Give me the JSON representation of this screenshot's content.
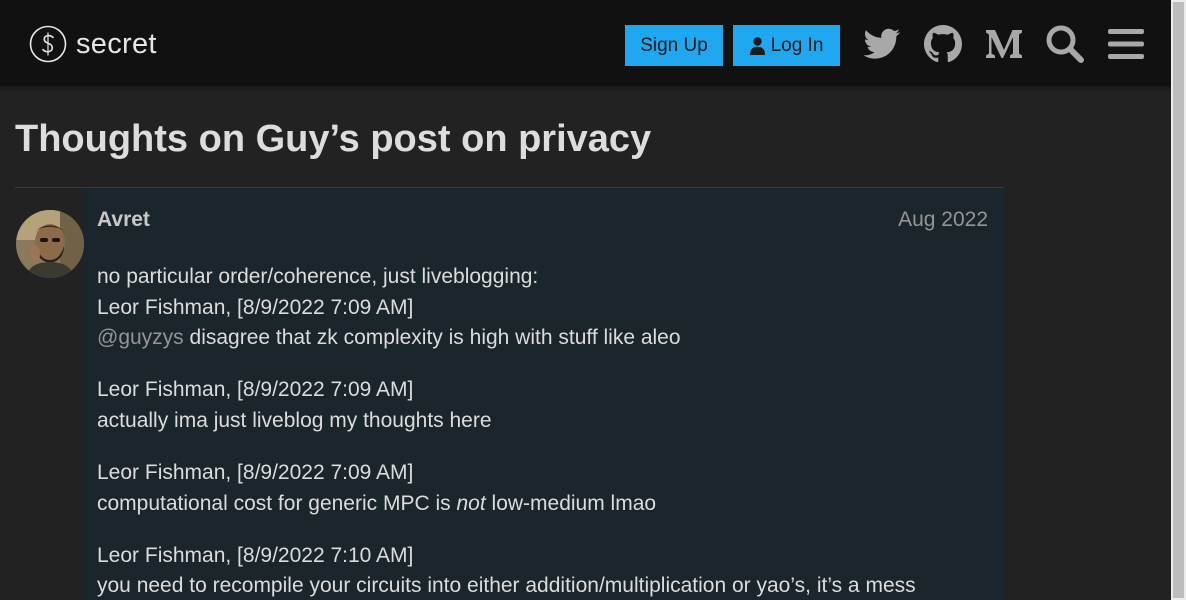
{
  "header": {
    "logo_text": "secret",
    "signup_label": "Sign Up",
    "login_label": "Log In",
    "icons": [
      "twitter-icon",
      "github-icon",
      "medium-icon",
      "search-icon",
      "menu-icon"
    ]
  },
  "topic": {
    "title": "Thoughts on Guy’s post on privacy"
  },
  "post": {
    "username": "Avret",
    "date": "Aug 2022",
    "intro": "no particular order/coherence, just liveblogging:",
    "entries": [
      {
        "author_time": "Leor Fishman, [8/9/2022 7:09 AM]",
        "mention": "@guyzys",
        "text": " disagree that zk complexity is high with stuff like aleo"
      },
      {
        "author_time": "Leor Fishman, [8/9/2022 7:09 AM]",
        "text": "actually ima just liveblog my thoughts here"
      },
      {
        "author_time": "Leor Fishman, [8/9/2022 7:09 AM]",
        "text_before": "computational cost for generic MPC is ",
        "text_em": "not",
        "text_after": " low-medium lmao"
      },
      {
        "author_time": "Leor Fishman, [8/9/2022 7:10 AM]",
        "text": "you need to recompile your circuits into either addition/multiplication or yao’s, it’s a mess"
      }
    ]
  },
  "colors": {
    "header_bg": "#111111",
    "page_bg": "#222222",
    "post_bg": "#1a252c",
    "button_bg": "#1fa8f0",
    "text": "#dcdcdc",
    "muted": "#959595"
  }
}
